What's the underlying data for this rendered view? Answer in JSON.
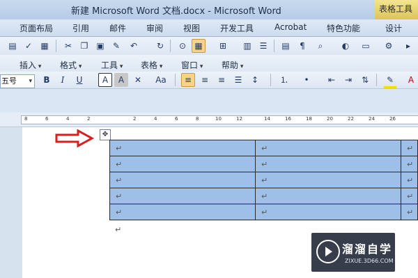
{
  "titlebar": {
    "title": "新建 Microsoft Word 文档.docx - Microsoft Word",
    "context_tab": "表格工具"
  },
  "ribbon_tabs": [
    "页面布局",
    "引用",
    "邮件",
    "审阅",
    "视图",
    "开发工具",
    "Acrobat",
    "特色功能",
    "设计"
  ],
  "menubar": [
    "插入",
    "格式",
    "工具",
    "表格",
    "窗口",
    "帮助"
  ],
  "format_bar": {
    "font_size": "五号",
    "buttons": [
      "B",
      "I",
      "U",
      "A",
      "A",
      "Aa"
    ]
  },
  "ruler": {
    "ticks": [
      "8",
      "6",
      "4",
      "2",
      "2",
      "4",
      "6",
      "8",
      "10",
      "12",
      "14",
      "16",
      "18",
      "20",
      "22",
      "24",
      "26"
    ]
  },
  "document": {
    "cell_mark": "↵",
    "rows": 5,
    "columns": 3
  },
  "watermark": {
    "title": "溜溜自学",
    "url": "ZIXUE.3D66.COM"
  },
  "colors": {
    "table_selection": "#9ec0e8",
    "arrow": "#d42020",
    "ribbon": "#cddcef",
    "context_tab": "#e8d36f"
  }
}
